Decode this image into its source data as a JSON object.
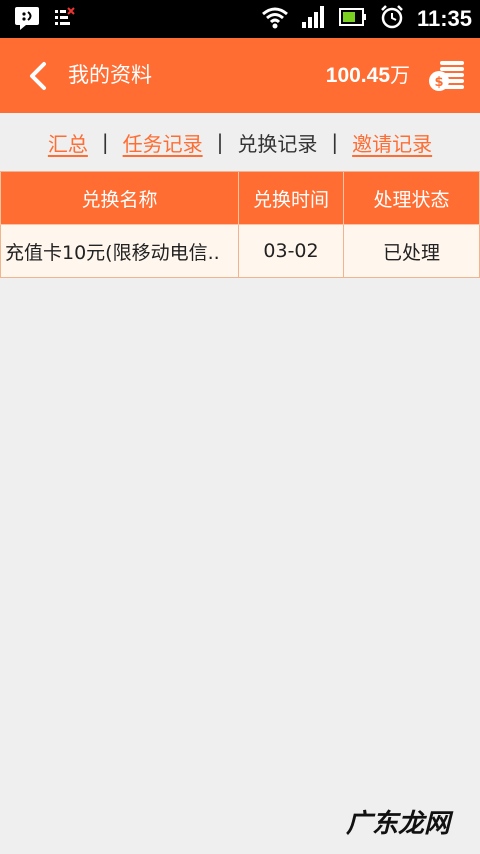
{
  "status_bar": {
    "time": "11:35",
    "icons": [
      "notification-face-icon",
      "signal-x-icon",
      "wifi-icon",
      "cell-signal-icon",
      "battery-icon",
      "alarm-icon"
    ]
  },
  "header": {
    "title": "我的资料",
    "balance_value": "100.45",
    "balance_unit": "万",
    "colors": {
      "accent": "#ff6d33"
    }
  },
  "tabs": {
    "items": [
      {
        "label": "汇总",
        "active": false
      },
      {
        "label": "任务记录",
        "active": false
      },
      {
        "label": "兑换记录",
        "active": true
      },
      {
        "label": "邀请记录",
        "active": false
      }
    ],
    "separator": "|"
  },
  "table": {
    "columns": [
      "兑换名称",
      "兑换时间",
      "处理状态"
    ],
    "rows": [
      {
        "name": "充值卡10元(限移动电信..",
        "time": "03-02",
        "status": "已处理"
      }
    ]
  },
  "watermark": "广东龙网"
}
